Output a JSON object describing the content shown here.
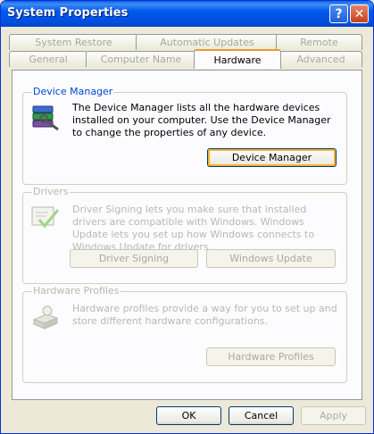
{
  "window": {
    "title": "System Properties",
    "help_glyph": "?",
    "close_glyph": "✕"
  },
  "tabs_row1": [
    {
      "label": "System Restore"
    },
    {
      "label": "Automatic Updates"
    },
    {
      "label": "Remote"
    }
  ],
  "tabs_row2": [
    {
      "label": "General"
    },
    {
      "label": "Computer Name"
    },
    {
      "label": "Hardware",
      "active": true
    },
    {
      "label": "Advanced"
    }
  ],
  "device_manager": {
    "title": "Device Manager",
    "description": "The Device Manager lists all the hardware devices installed on your computer. Use the Device Manager to change the properties of any device.",
    "button": "Device Manager"
  },
  "drivers": {
    "title": "Drivers",
    "description": "Driver Signing lets you make sure that installed drivers are compatible with Windows. Windows Update lets you set up how Windows connects to Windows Update for drivers.",
    "driver_signing_button": "Driver Signing",
    "windows_update_button": "Windows Update"
  },
  "hardware_profiles": {
    "title": "Hardware Profiles",
    "description": "Hardware profiles provide a way for you to set up and store different hardware configurations.",
    "button": "Hardware Profiles"
  },
  "footer": {
    "ok": "OK",
    "cancel": "Cancel",
    "apply": "Apply"
  },
  "colors": {
    "title_bar": "#0058ee",
    "group_label": "#0046d5",
    "focus_ring": "#f8b330",
    "active_tab_accent": "#e89a2c"
  }
}
